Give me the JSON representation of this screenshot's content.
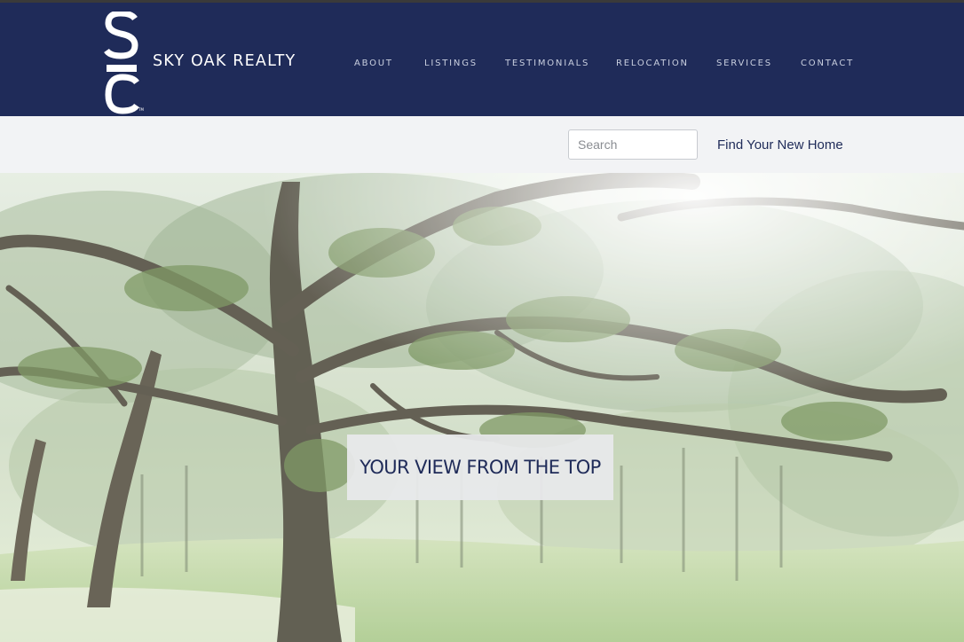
{
  "brand": {
    "logo_text": "SIC",
    "name": "SKY OAK REALTY"
  },
  "nav": {
    "items": [
      {
        "label": "ABOUT"
      },
      {
        "label": "LISTINGS"
      },
      {
        "label": "TESTIMONIALS"
      },
      {
        "label": "RELOCATION"
      },
      {
        "label": "SERVICES"
      },
      {
        "label": "CONTACT"
      }
    ]
  },
  "search": {
    "placeholder": "Search",
    "value": ""
  },
  "find_home": {
    "label": "Find Your New Home"
  },
  "hero": {
    "image": "oak-trees-photo",
    "tagline": "YOUR VIEW FROM THE TOP"
  },
  "colors": {
    "header_bg": "#1f2b59",
    "nav_text": "#c9cfdf",
    "subbar_bg": "#f2f3f5",
    "accent": "#1f2b59",
    "tagline_box": "#e8e9eb"
  }
}
